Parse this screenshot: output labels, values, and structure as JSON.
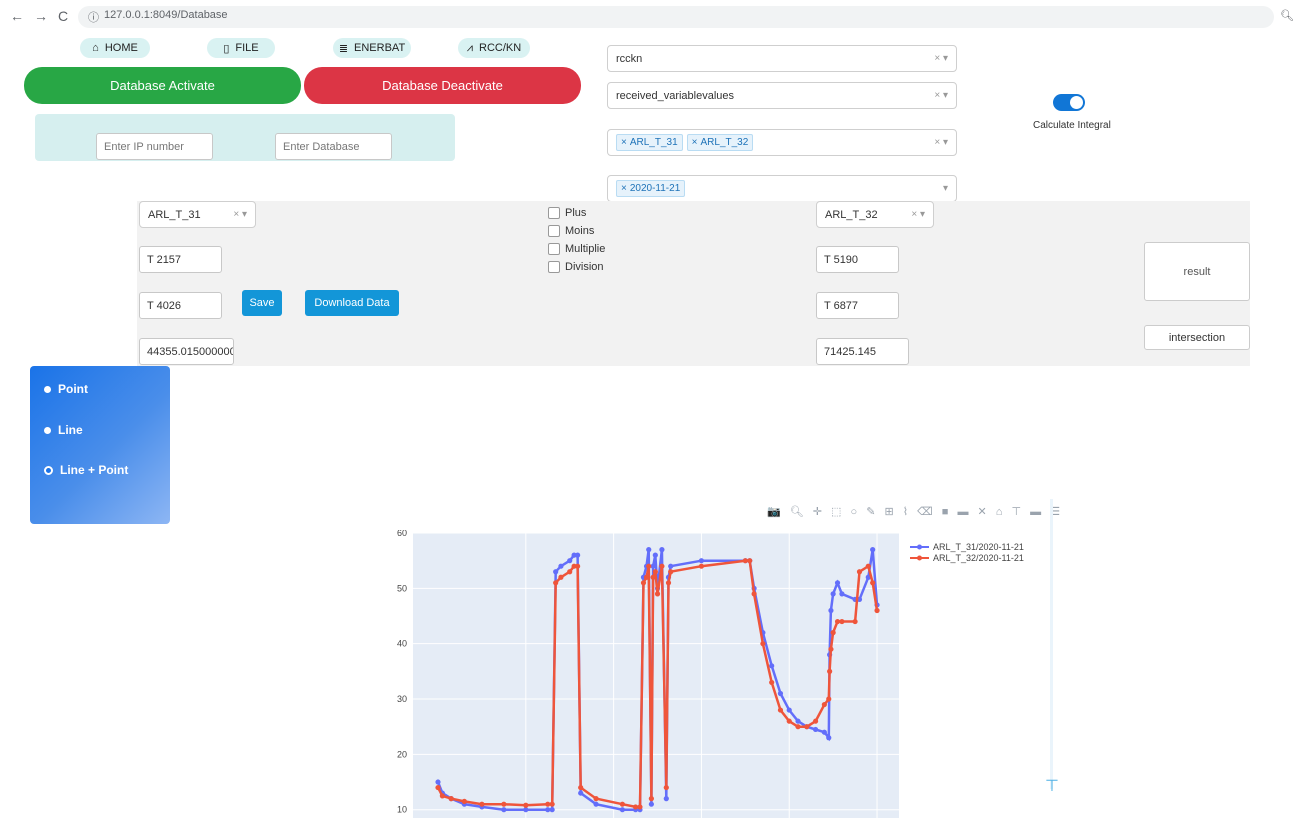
{
  "browser": {
    "back": "←",
    "forward": "→",
    "reload": "C",
    "info": "ⓘ",
    "url": "127.0.0.1:8049/Database",
    "zoom": "🔍︎"
  },
  "nav": {
    "home": "HOME",
    "file": "FILE",
    "enerbat": "ENERBAT",
    "rcc": "RCC/KN"
  },
  "db": {
    "activate": "Database Activate",
    "deactivate": "Database Deactivate",
    "ip_placeholder": "Enter IP number",
    "db_placeholder": "Enter Database"
  },
  "selectors": {
    "database": "rcckn",
    "table": "received_variablevalues",
    "variables": [
      "ARL_T_31",
      "ARL_T_32"
    ],
    "dates": [
      "2020-11-21"
    ],
    "clear": "×",
    "arrow": "▾"
  },
  "integral": {
    "label": "Calculate Integral",
    "on": true
  },
  "calc": {
    "left_var": "ARL_T_31",
    "left_t1": "T 2157",
    "left_t2": "T 4026",
    "left_value": "44355.015000000",
    "save": "Save",
    "download": "Download Data",
    "ops": [
      "Plus",
      "Moins",
      "Multiplie",
      "Division"
    ],
    "right_var": "ARL_T_32",
    "right_t1": "T 5190",
    "right_t2": "T 6877",
    "right_value": "71425.145",
    "result": "result",
    "intersection": "intersection"
  },
  "modes": {
    "point": "Point",
    "line": "Line",
    "linepoint": "Line + Point",
    "selected": "linepoint"
  },
  "modebar": "📷 🔍︎ ✛ ⬚ ○ ✎ ⊞ ⌇ ⌫ ■ ▬ ✕ ⌂ ⊤ ▬ ☰",
  "colors": {
    "green": "#28a745",
    "red": "#dc3545",
    "blue": "#1396d8",
    "series1": "#636efa",
    "series2": "#ef553b"
  },
  "chart_data": {
    "type": "line",
    "ylim": [
      8.5,
      60
    ],
    "yticks": [
      10,
      20,
      30,
      40,
      50,
      60
    ],
    "series": [
      {
        "name": "ARL_T_31/2020-11-21",
        "x": [
          0,
          1,
          3,
          6,
          10,
          15,
          20,
          25,
          26,
          26.8,
          28,
          30,
          31,
          31.8,
          32.5,
          36,
          42,
          45,
          46,
          46.8,
          47.5,
          48,
          48.6,
          49,
          49.5,
          50,
          51,
          52,
          52.5,
          53,
          60,
          70,
          71,
          72,
          74,
          76,
          78,
          80,
          82,
          84,
          86,
          88,
          89,
          89.2,
          89.5,
          90,
          91,
          92,
          95,
          96,
          98,
          99,
          100
        ],
        "values": [
          15,
          13,
          12,
          11,
          10.5,
          10,
          10,
          10,
          10,
          53,
          54,
          55,
          56,
          56,
          13,
          11,
          10,
          10,
          10,
          52,
          54,
          57,
          11,
          54,
          56,
          50,
          57,
          12,
          52,
          54,
          55,
          55,
          55,
          50,
          42,
          36,
          31,
          28,
          26,
          25,
          24.5,
          24,
          23,
          38,
          46,
          49,
          51,
          49,
          48,
          48,
          52,
          57,
          47
        ]
      },
      {
        "name": "ARL_T_32/2020-11-21",
        "x": [
          0,
          1,
          3,
          6,
          10,
          15,
          20,
          25,
          26,
          26.8,
          28,
          30,
          31,
          31.8,
          32.5,
          36,
          42,
          45,
          46,
          46.8,
          47.5,
          48,
          48.6,
          49,
          49.5,
          50,
          51,
          52,
          52.5,
          53,
          60,
          70,
          71,
          72,
          74,
          76,
          78,
          80,
          82,
          84,
          86,
          88,
          89,
          89.2,
          89.5,
          90,
          91,
          92,
          95,
          96,
          98,
          99,
          100
        ],
        "values": [
          14,
          12.5,
          12,
          11.5,
          11,
          11,
          10.8,
          11,
          11,
          51,
          52,
          53,
          54,
          54,
          14,
          12,
          11,
          10.5,
          10.5,
          51,
          52,
          54,
          12,
          52,
          53,
          49,
          54,
          14,
          51,
          53,
          54,
          55,
          55,
          49,
          40,
          33,
          28,
          26,
          25,
          25,
          26,
          29,
          30,
          35,
          39,
          42,
          44,
          44,
          44,
          53,
          54,
          51,
          46
        ]
      }
    ]
  }
}
